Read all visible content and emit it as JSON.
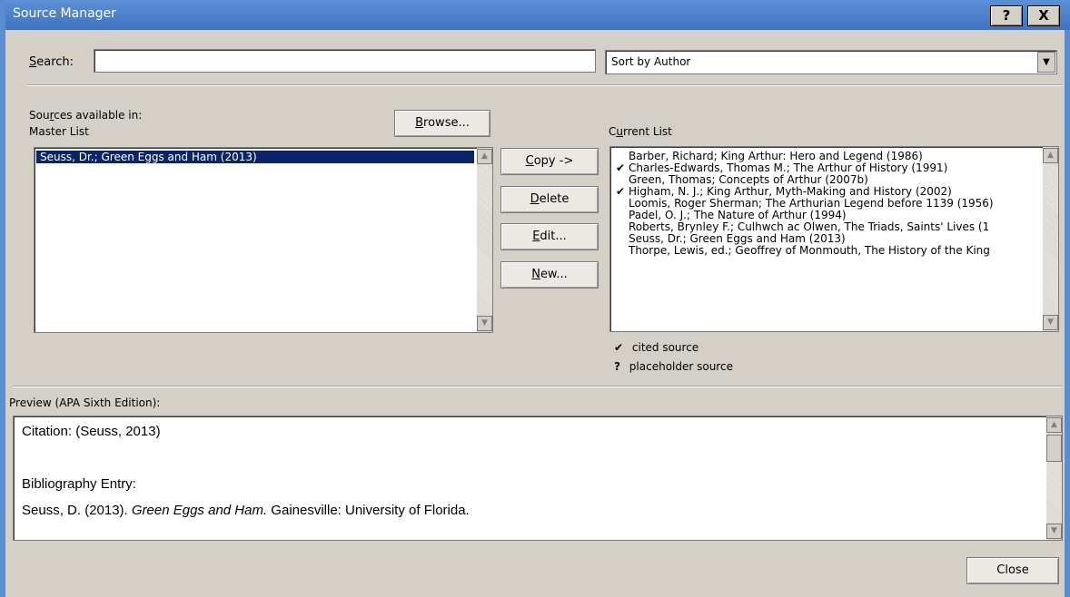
{
  "window": {
    "title": "Source Manager",
    "help_label": "?",
    "close_label": "X"
  },
  "search": {
    "label_pre": "",
    "label_accel": "S",
    "label_post": "earch:",
    "value": ""
  },
  "sort": {
    "selected": "Sort by Author",
    "dropdown_icon": "down-arrow-icon"
  },
  "sources_available": {
    "label_pre": "Sou",
    "label_accel": "r",
    "label_post": "ces available in:",
    "location": "Master List"
  },
  "browse_button": {
    "accel": "B",
    "rest": "rowse..."
  },
  "master_list": {
    "items": [
      "Seuss, Dr.; Green Eggs and Ham (2013)"
    ],
    "selected_index": 0
  },
  "actions": {
    "copy": {
      "accel": "C",
      "rest": "opy ->"
    },
    "delete": {
      "accel": "D",
      "rest": "elete"
    },
    "edit": {
      "accel": "E",
      "rest": "dit..."
    },
    "new": {
      "accel": "N",
      "rest": "ew..."
    }
  },
  "current_list": {
    "label_pre": "C",
    "label_accel": "u",
    "label_post": "rrent List",
    "items": [
      {
        "text": "Barber, Richard; King Arthur: Hero and Legend (1986)",
        "mark": ""
      },
      {
        "text": "Charles-Edwards, Thomas M.; The Arthur of History (1991)",
        "mark": "✔"
      },
      {
        "text": "Green, Thomas; Concepts of Arthur (2007b)",
        "mark": ""
      },
      {
        "text": "Higham, N. J.; King Arthur, Myth-Making and History (2002)",
        "mark": "✔"
      },
      {
        "text": "Loomis, Roger Sherman; The Arthurian Legend before 1139 (1956)",
        "mark": ""
      },
      {
        "text": "Padel, O. J.; The Nature of Arthur (1994)",
        "mark": ""
      },
      {
        "text": "Roberts, Brynley F.; Culhwch ac Olwen, The Triads, Saints' Lives (1",
        "mark": ""
      },
      {
        "text": "Seuss, Dr.; Green Eggs and Ham (2013)",
        "mark": ""
      },
      {
        "text": "Thorpe, Lewis, ed.; Geoffrey of Monmouth, The History of the King",
        "mark": ""
      }
    ]
  },
  "legend": {
    "cited_symbol": "✔",
    "cited_label": "cited source",
    "placeholder_symbol": "?",
    "placeholder_label": "placeholder source"
  },
  "preview": {
    "label": "Preview (APA Sixth Edition):",
    "citation": "Citation:  (Seuss, 2013)",
    "bibliography_heading": "Bibliography Entry:",
    "bib_author": "Seuss, D. (2013). ",
    "bib_title": "Green Eggs and Ham.",
    "bib_rest": " Gainesville: University of Florida."
  },
  "close_button": "Close",
  "colors": {
    "titlebar": "#4a7ecb",
    "selection": "#0a246a",
    "dialog": "#d4d0c8"
  }
}
